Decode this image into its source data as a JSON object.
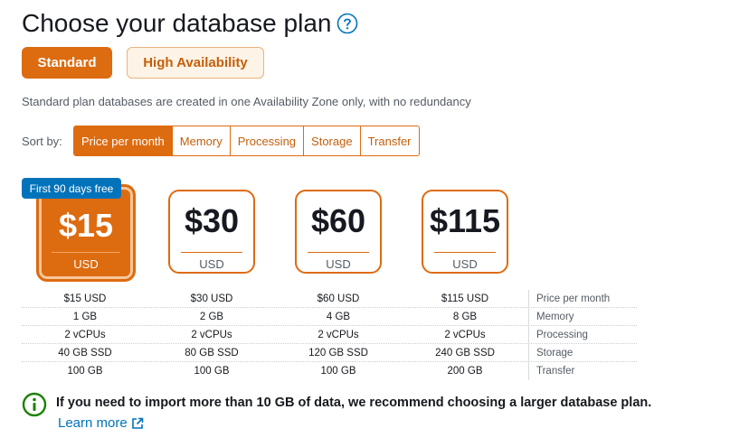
{
  "header": {
    "title": "Choose your database plan",
    "help_icon": "help-circle-icon"
  },
  "plan_types": {
    "standard": "Standard",
    "high_availability": "High Availability",
    "selected": "Standard"
  },
  "description": "Standard plan databases are created in one Availability Zone only, with no redundancy",
  "sort": {
    "label": "Sort by:",
    "options": [
      "Price per month",
      "Memory",
      "Processing",
      "Storage",
      "Transfer"
    ],
    "selected": "Price per month"
  },
  "badge": "First 90 days free",
  "plans": [
    {
      "price": "$15",
      "currency": "USD",
      "selected": true,
      "specs": [
        "$15 USD",
        "1 GB",
        "2 vCPUs",
        "40 GB SSD",
        "100 GB"
      ]
    },
    {
      "price": "$30",
      "currency": "USD",
      "selected": false,
      "specs": [
        "$30 USD",
        "2 GB",
        "2 vCPUs",
        "80 GB SSD",
        "100 GB"
      ]
    },
    {
      "price": "$60",
      "currency": "USD",
      "selected": false,
      "specs": [
        "$60 USD",
        "4 GB",
        "2 vCPUs",
        "120 GB SSD",
        "100 GB"
      ]
    },
    {
      "price": "$115",
      "currency": "USD",
      "selected": false,
      "specs": [
        "$115 USD",
        "8 GB",
        "2 vCPUs",
        "240 GB SSD",
        "200 GB"
      ]
    }
  ],
  "spec_labels": [
    "Price per month",
    "Memory",
    "Processing",
    "Storage",
    "Transfer"
  ],
  "info": {
    "icon": "info-circle-icon",
    "text": "If you need to import more than 10 GB of data, we recommend choosing a larger database plan.",
    "link": "Learn more",
    "link_icon": "external-link-icon"
  },
  "colors": {
    "accent": "#dd6b10",
    "info_green": "#1d8102",
    "link_blue": "#0073bb",
    "badge_blue": "#0073bb"
  }
}
